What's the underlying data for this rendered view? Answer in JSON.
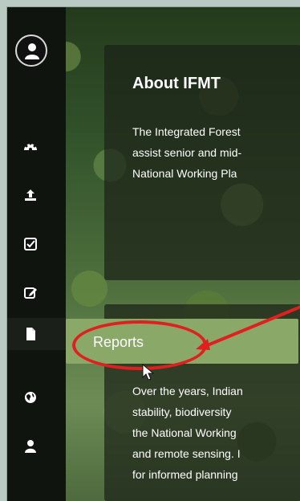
{
  "sidebar": {
    "items": [
      {
        "icon": "avatar-icon"
      },
      {
        "icon": "dashboard-icon"
      },
      {
        "icon": "upload-icon"
      },
      {
        "icon": "checkbox-icon"
      },
      {
        "icon": "edit-icon"
      },
      {
        "icon": "document-icon"
      },
      {
        "icon": "globe-icon"
      },
      {
        "icon": "user-icon"
      }
    ]
  },
  "about": {
    "title": "About IFMT",
    "lines": [
      "The Integrated Forest",
      "assist senior and mid-",
      "National Working Pla"
    ]
  },
  "reports": {
    "label": "Reports"
  },
  "history": {
    "lines": [
      "Over the years, Indian",
      "stability, biodiversity",
      "the National Working",
      "and remote sensing. I",
      "for informed planning"
    ]
  },
  "colors": {
    "sidebar": "#0f140f",
    "reports_bg": "#8aa867",
    "annotation": "#e02020"
  }
}
